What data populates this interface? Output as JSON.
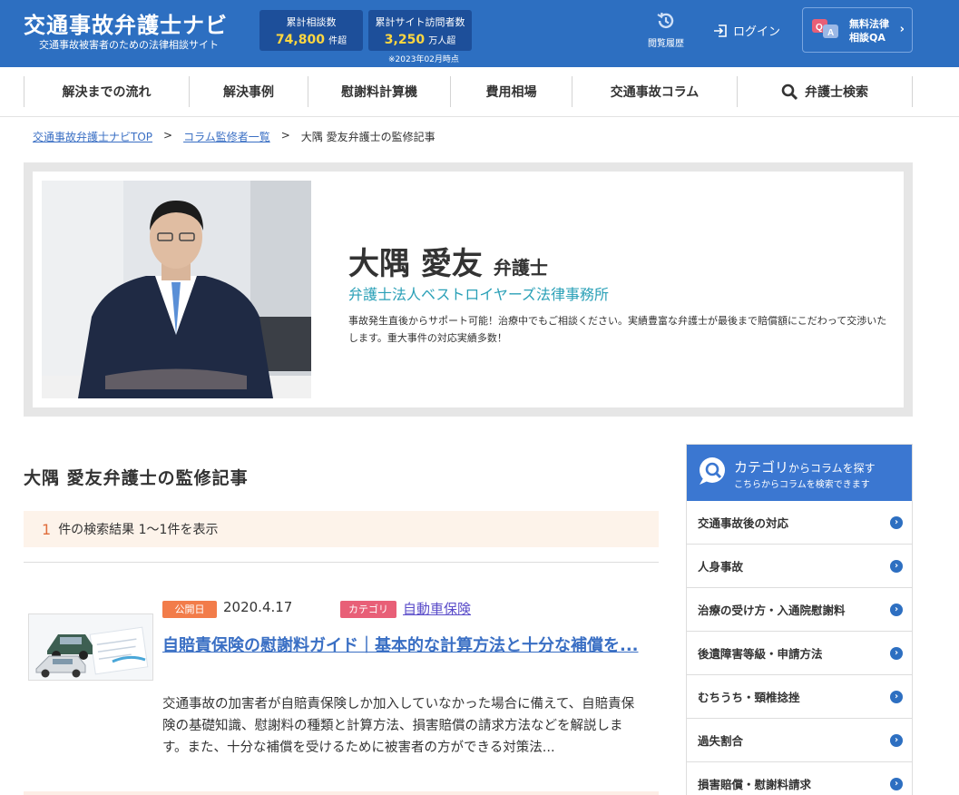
{
  "header": {
    "logo_title": "交通事故弁護士ナビ",
    "logo_sub": "交通事故被害者のための法律相談サイト",
    "stats": [
      {
        "label": "累計相談数",
        "value": "74,800",
        "unit": "件超"
      },
      {
        "label": "累計サイト訪問者数",
        "value": "3,250",
        "unit": "万人超"
      }
    ],
    "stats_note": "※2023年02月時点",
    "history_label": "閲覧履歴",
    "login_label": "ログイン",
    "qa_line1": "無料法律",
    "qa_line2": "相談QA",
    "qa_chevron": "›",
    "qa_icon_q": "Q",
    "qa_icon_a": "A"
  },
  "nav": {
    "items": [
      "解決までの流れ",
      "解決事例",
      "慰謝料計算機",
      "費用相場",
      "交通事故コラム",
      "弁護士検索"
    ]
  },
  "breadcrumb": {
    "home": "交通事故弁護士ナビTOP",
    "sep1": ">",
    "list": "コラム監修者一覧",
    "sep2": ">",
    "current": "大隅 愛友弁護士の監修記事"
  },
  "profile": {
    "name": "大隅 愛友",
    "title": "弁護士",
    "firm": "弁護士法人ベストロイヤーズ法律事務所",
    "description": "事故発生直後からサポート可能！治療中でもご相談ください。実績豊富な弁護士が最後まで賠償額にこだわって交渉いたします。重大事件の対応実績多数！"
  },
  "main": {
    "title": "大隅 愛友弁護士の監修記事",
    "result_count": "1",
    "result_text": "件の検索結果 1〜1件を表示"
  },
  "article": {
    "date_tag": "公開日",
    "date": "2020.4.17",
    "category_tag": "カテゴリ",
    "category": "自動車保険",
    "title": "自賠責保険の慰謝料ガイド｜基本的な計算方法と十分な補償を...",
    "excerpt": "交通事故の加害者が自賠責保険しか加入していなかった場合に備えて、自賠責保険の基礎知識、慰謝料の種類と計算方法、損害賠償の請求方法などを解説します。また、十分な補償を受けるために被害者の方ができる対策法..."
  },
  "sidebar": {
    "head_main": "カテゴリ",
    "head_main_small": "からコラムを探す",
    "head_sub": "こちらからコラムを検索できます",
    "items": [
      "交通事故後の対応",
      "人身事故",
      "治療の受け方・入通院慰謝料",
      "後遺障害等級・申請方法",
      "むちうち・頸椎捻挫",
      "過失割合",
      "損害賠償・慰謝料請求"
    ],
    "chevron": "›"
  },
  "colors": {
    "header_bg": "#2d6fc1",
    "accent_orange": "#f27c4a",
    "accent_pink": "#e85f77",
    "link_blue": "#3a6fc4",
    "firm_teal": "#2aa0b7"
  }
}
